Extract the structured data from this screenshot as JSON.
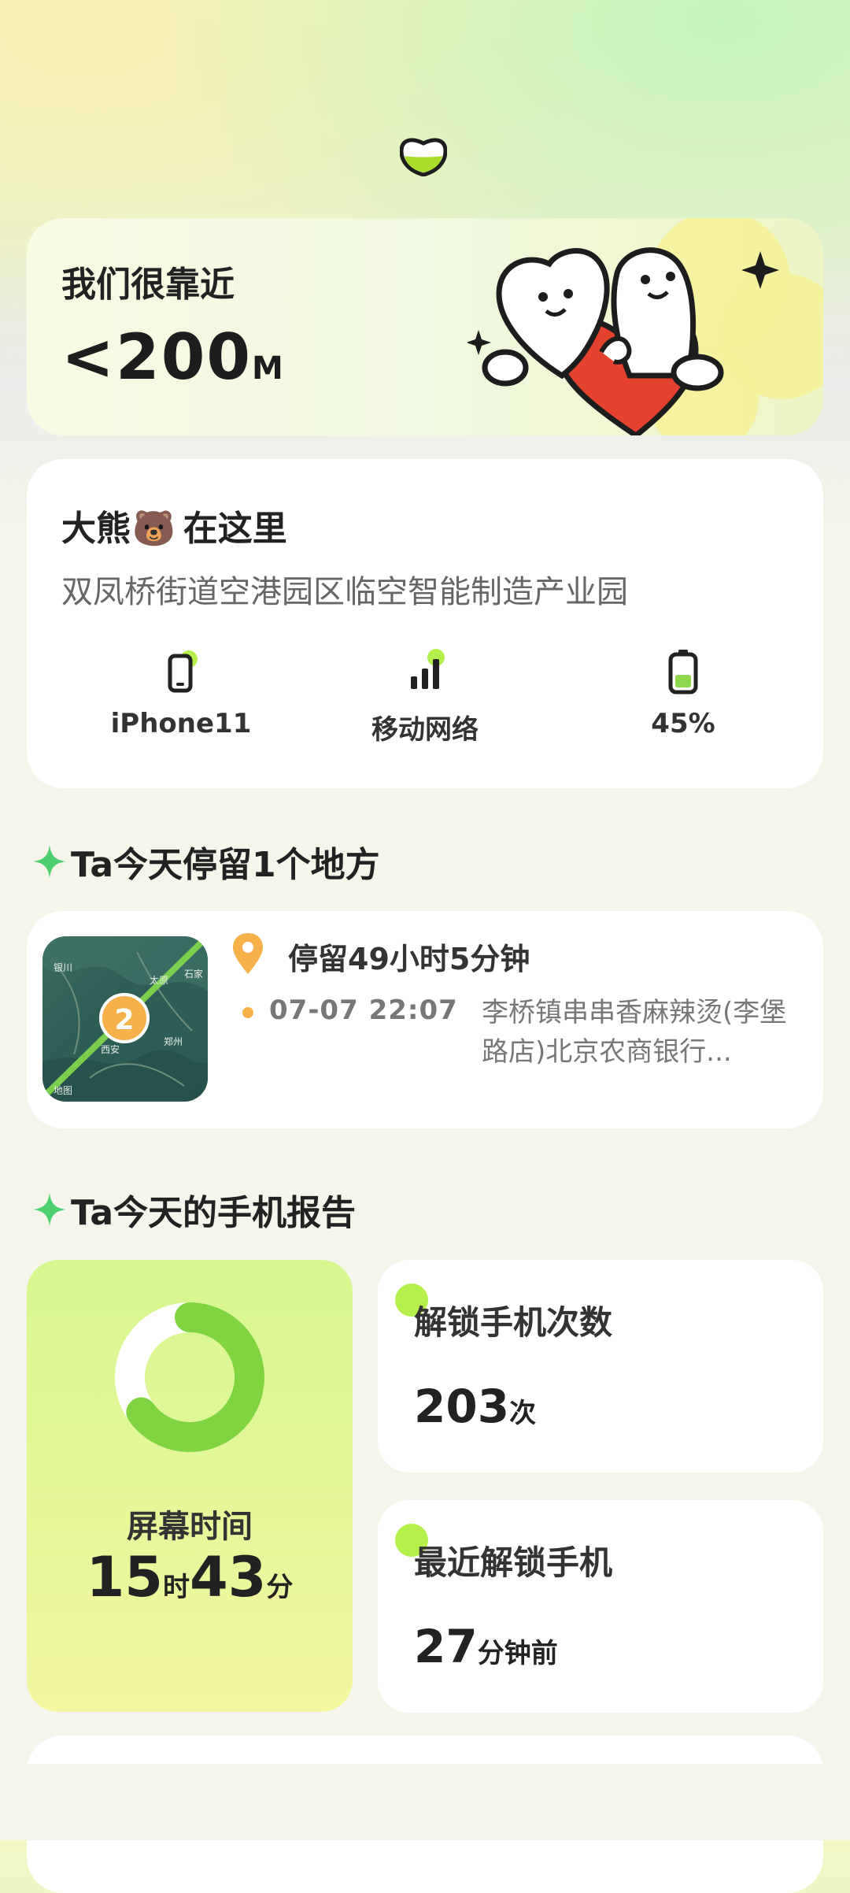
{
  "distance": {
    "title": "我们很靠近",
    "value": "<200",
    "unit": "M"
  },
  "location": {
    "name_prefix": "大熊",
    "name_emoji": "🐻",
    "name_suffix": "在这里",
    "address": "双凤桥街道空港园区临空智能制造产业园",
    "device": "iPhone11",
    "network": "移动网络",
    "battery": "45%",
    "battery_level": 0.45
  },
  "stays": {
    "heading": "Ta今天停留1个地方",
    "map_count": "2",
    "map_labels": [
      "银川",
      "太原",
      "石家",
      "西安",
      "郑州",
      "地图"
    ],
    "duration": "停留49小时5分钟",
    "time": "07-07 22:07",
    "place": "李桥镇串串香麻辣烫(李堡路店)北京农商银行..."
  },
  "report": {
    "heading": "Ta今天的手机报告",
    "screen_time_label": "屏幕时间",
    "screen_hours": "15",
    "hours_unit": "时",
    "screen_minutes": "43",
    "minutes_unit": "分",
    "ring_fraction": 0.65,
    "unlock_title": "解锁手机次数",
    "unlock_count": "203",
    "unlock_unit": "次",
    "recent_title": "最近解锁手机",
    "recent_value": "27",
    "recent_unit": "分钟前"
  },
  "colors": {
    "accent_green": "#8cd84a",
    "accent_orange": "#f6b14a",
    "heart_red": "#e5412f"
  }
}
